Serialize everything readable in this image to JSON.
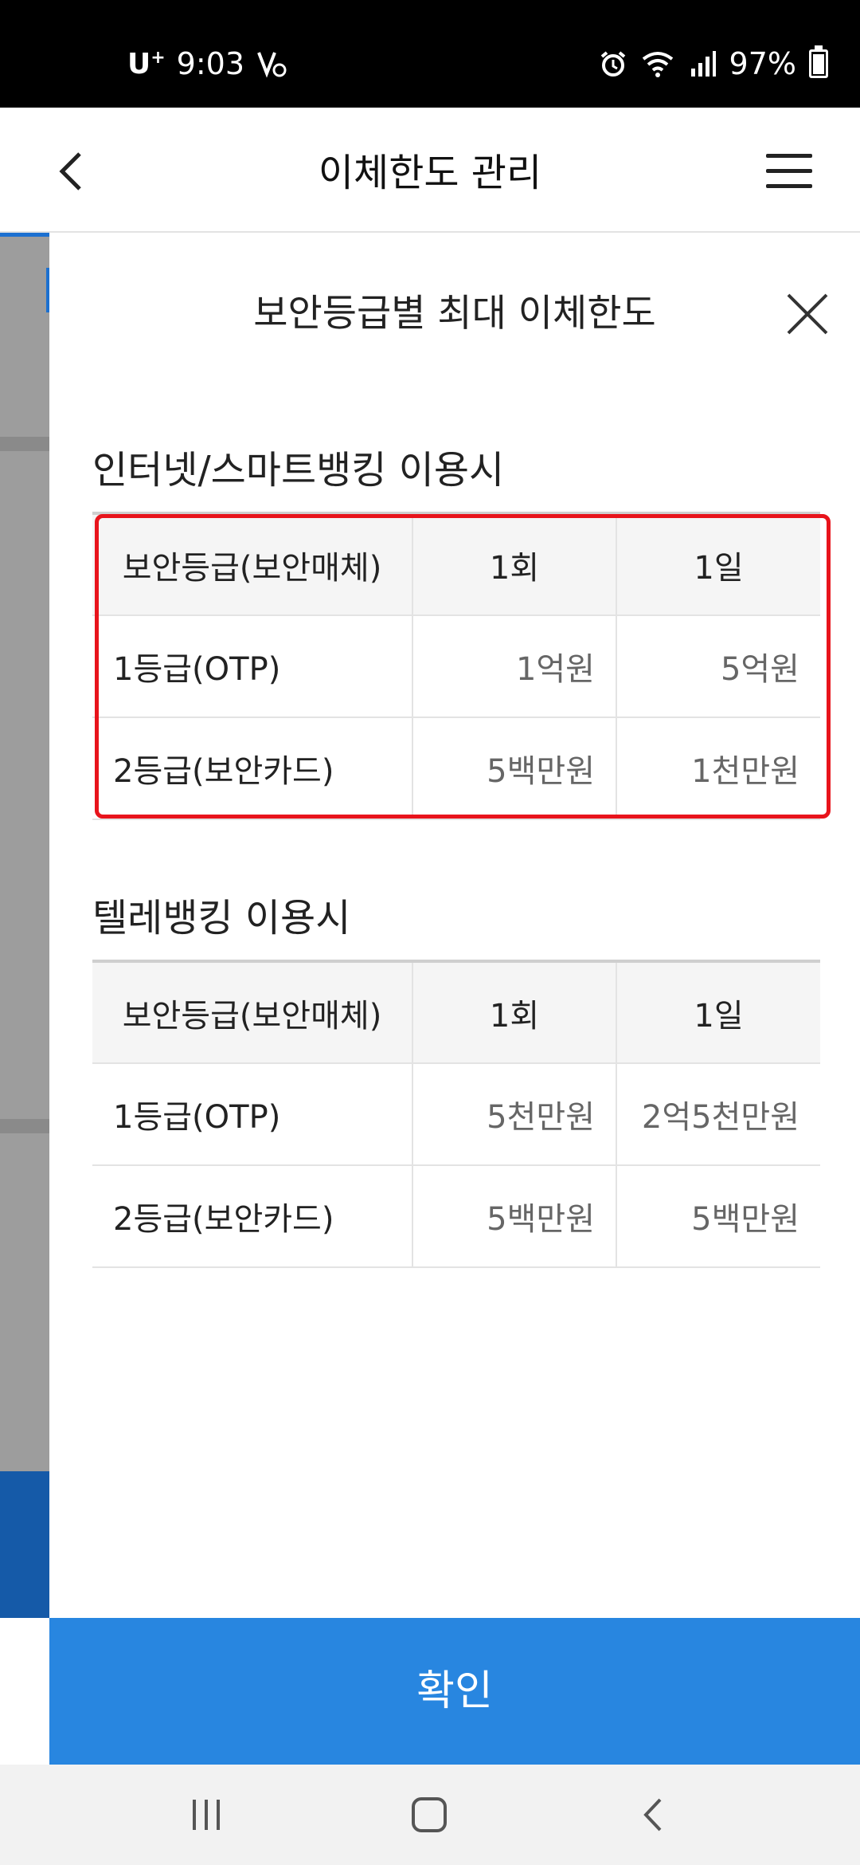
{
  "status_bar": {
    "carrier": "U",
    "carrier_sup": "+",
    "time": "9:03",
    "battery": "97%",
    "icons": [
      "alarm-icon",
      "wifi-icon",
      "signal-icon",
      "battery-icon"
    ]
  },
  "header": {
    "title": "이체한도 관리",
    "back_icon": "chevron-left-icon",
    "menu_icon": "hamburger-menu-icon"
  },
  "modal": {
    "title": "보안등급별 최대 이체한도",
    "close_icon": "close-icon",
    "sections": [
      {
        "title": "인터넷/스마트뱅킹 이용시",
        "headers": [
          "보안등급(보안매체)",
          "1회",
          "1일"
        ],
        "rows": [
          [
            "1등급(OTP)",
            "1억원",
            "5억원"
          ],
          [
            "2등급(보안카드)",
            "5백만원",
            "1천만원"
          ]
        ]
      },
      {
        "title": "텔레뱅킹 이용시",
        "headers": [
          "보안등급(보안매체)",
          "1회",
          "1일"
        ],
        "rows": [
          [
            "1등급(OTP)",
            "5천만원",
            "2억5천만원"
          ],
          [
            "2등급(보안카드)",
            "5백만원",
            "5백만원"
          ]
        ]
      }
    ],
    "confirm_label": "확인"
  },
  "colors": {
    "accent": "#2886e0",
    "highlight": "#e8141c"
  },
  "nav_bar": {
    "items": [
      "recent-apps-icon",
      "home-icon",
      "back-icon"
    ]
  }
}
